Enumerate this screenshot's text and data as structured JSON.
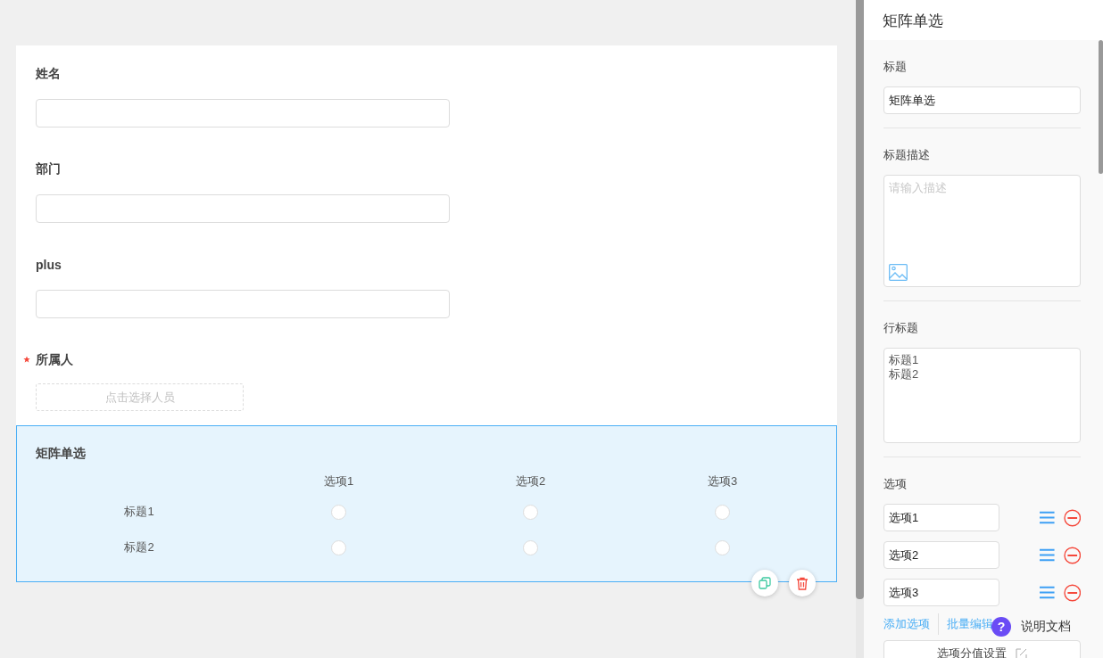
{
  "form": {
    "fields": [
      {
        "kind": "text",
        "label": "姓名",
        "required": false
      },
      {
        "kind": "text",
        "label": "部门",
        "required": false
      },
      {
        "kind": "text",
        "label": "plus",
        "required": false
      },
      {
        "kind": "person",
        "label": "所属人",
        "required": true,
        "placeholder": "点击选择人员"
      }
    ],
    "matrix": {
      "title": "矩阵单选",
      "selected": true,
      "columns": [
        "选项1",
        "选项2",
        "选项3"
      ],
      "rows": [
        {
          "label": "标题1",
          "cells": [
            {
              "selected": false
            },
            {
              "selected": false
            },
            {
              "selected": false
            }
          ]
        },
        {
          "label": "标题2",
          "cells": [
            {
              "selected": false
            },
            {
              "selected": false
            },
            {
              "selected": false
            }
          ]
        }
      ]
    }
  },
  "panel": {
    "header": "矩阵单选",
    "title_label": "标题",
    "title_value": "矩阵单选",
    "desc_label": "标题描述",
    "desc_placeholder": "请输入描述",
    "rows_label": "行标题",
    "rows_value": "标题1\n标题2",
    "options_label": "选项",
    "options": [
      "选项1",
      "选项2",
      "选项3"
    ],
    "add_option": "添加选项",
    "batch_edit": "批量编辑",
    "score_button": "选项分值设置"
  },
  "help": {
    "icon": "?",
    "label": "说明文档"
  }
}
